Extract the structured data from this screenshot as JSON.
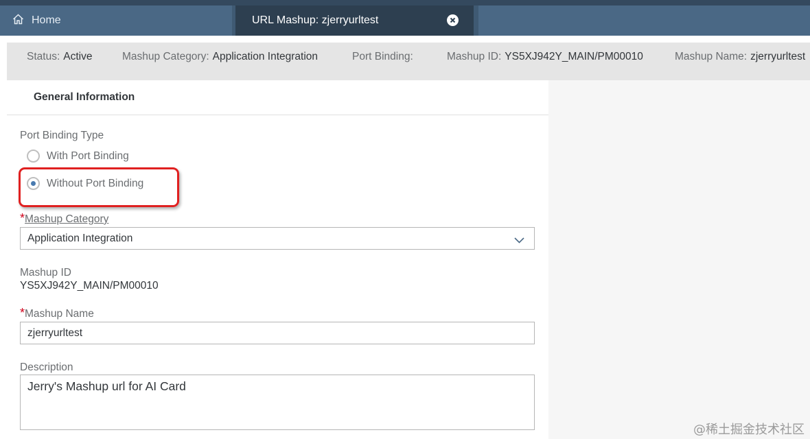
{
  "tabs": {
    "home_label": "Home",
    "active_label": "URL Mashup: zjerryurltest"
  },
  "status": {
    "status_label": "Status:",
    "status_value": "Active",
    "category_label": "Mashup Category:",
    "category_value": "Application Integration",
    "port_label": "Port Binding:",
    "port_value": "",
    "id_label": "Mashup ID:",
    "id_value": "YS5XJ942Y_MAIN/PM00010",
    "name_label": "Mashup Name:",
    "name_value": "zjerryurltest"
  },
  "section": {
    "title": "General Information"
  },
  "form": {
    "port_binding_type_label": "Port Binding Type",
    "option_with": "With Port Binding",
    "option_without": "Without Port Binding",
    "selected_option": "Without Port Binding",
    "required_mark": "*",
    "category_label": "Mashup Category",
    "category_value": "Application Integration",
    "mashup_id_label": "Mashup ID",
    "mashup_id_value": "YS5XJ942Y_MAIN/PM00010",
    "mashup_name_label": "Mashup Name",
    "mashup_name_value": "zjerryurltest",
    "description_label": "Description",
    "description_value": "Jerry's Mashup url for AI Card"
  },
  "watermark": "@稀土掘金技术社区",
  "icons": {
    "home": "home-icon",
    "close": "close-icon",
    "dropdown": "chevron-down-icon"
  },
  "colors": {
    "header_bg": "#3f5a73",
    "active_tab_bg": "#2d3f50",
    "status_bar_bg": "#e5e5e5",
    "required": "#d0021b",
    "radio_selected": "#4a7bb0",
    "highlight_border": "#e02020"
  }
}
